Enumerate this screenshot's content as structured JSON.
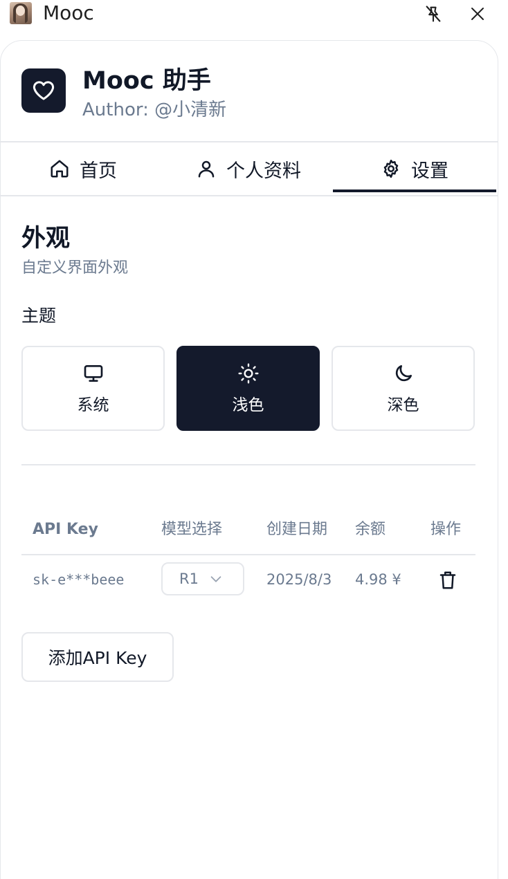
{
  "window": {
    "title": "Mooc",
    "avatar_icon": "user-avatar-icon",
    "pin_icon": "unpin-icon",
    "close_icon": "close-icon"
  },
  "header": {
    "app_name": "Mooc 助手",
    "author": "Author: @小清新",
    "logo_icon": "heart-icon"
  },
  "tabs": [
    {
      "label": "首页",
      "icon": "home-icon",
      "active": false
    },
    {
      "label": "个人资料",
      "icon": "user-icon",
      "active": false
    },
    {
      "label": "设置",
      "icon": "gear-icon",
      "active": true
    }
  ],
  "appearance": {
    "title": "外观",
    "description": "自定义界面外观",
    "theme_label": "主题",
    "options": [
      {
        "label": "系统",
        "icon": "monitor-icon",
        "selected": false
      },
      {
        "label": "浅色",
        "icon": "sun-icon",
        "selected": true
      },
      {
        "label": "深色",
        "icon": "moon-icon",
        "selected": false
      }
    ]
  },
  "api_table": {
    "headers": [
      "API Key",
      "模型选择",
      "创建日期",
      "余额",
      "操作"
    ],
    "rows": [
      {
        "key": "sk-e***beee",
        "model": "R1",
        "date": "2025/8/3",
        "balance": "4.98 ¥",
        "action_icon": "trash-icon"
      }
    ]
  },
  "add_button": "添加API Key",
  "colors": {
    "primary": "#141a2c",
    "muted_text": "#6b7a8f",
    "border": "#e5e7eb"
  }
}
